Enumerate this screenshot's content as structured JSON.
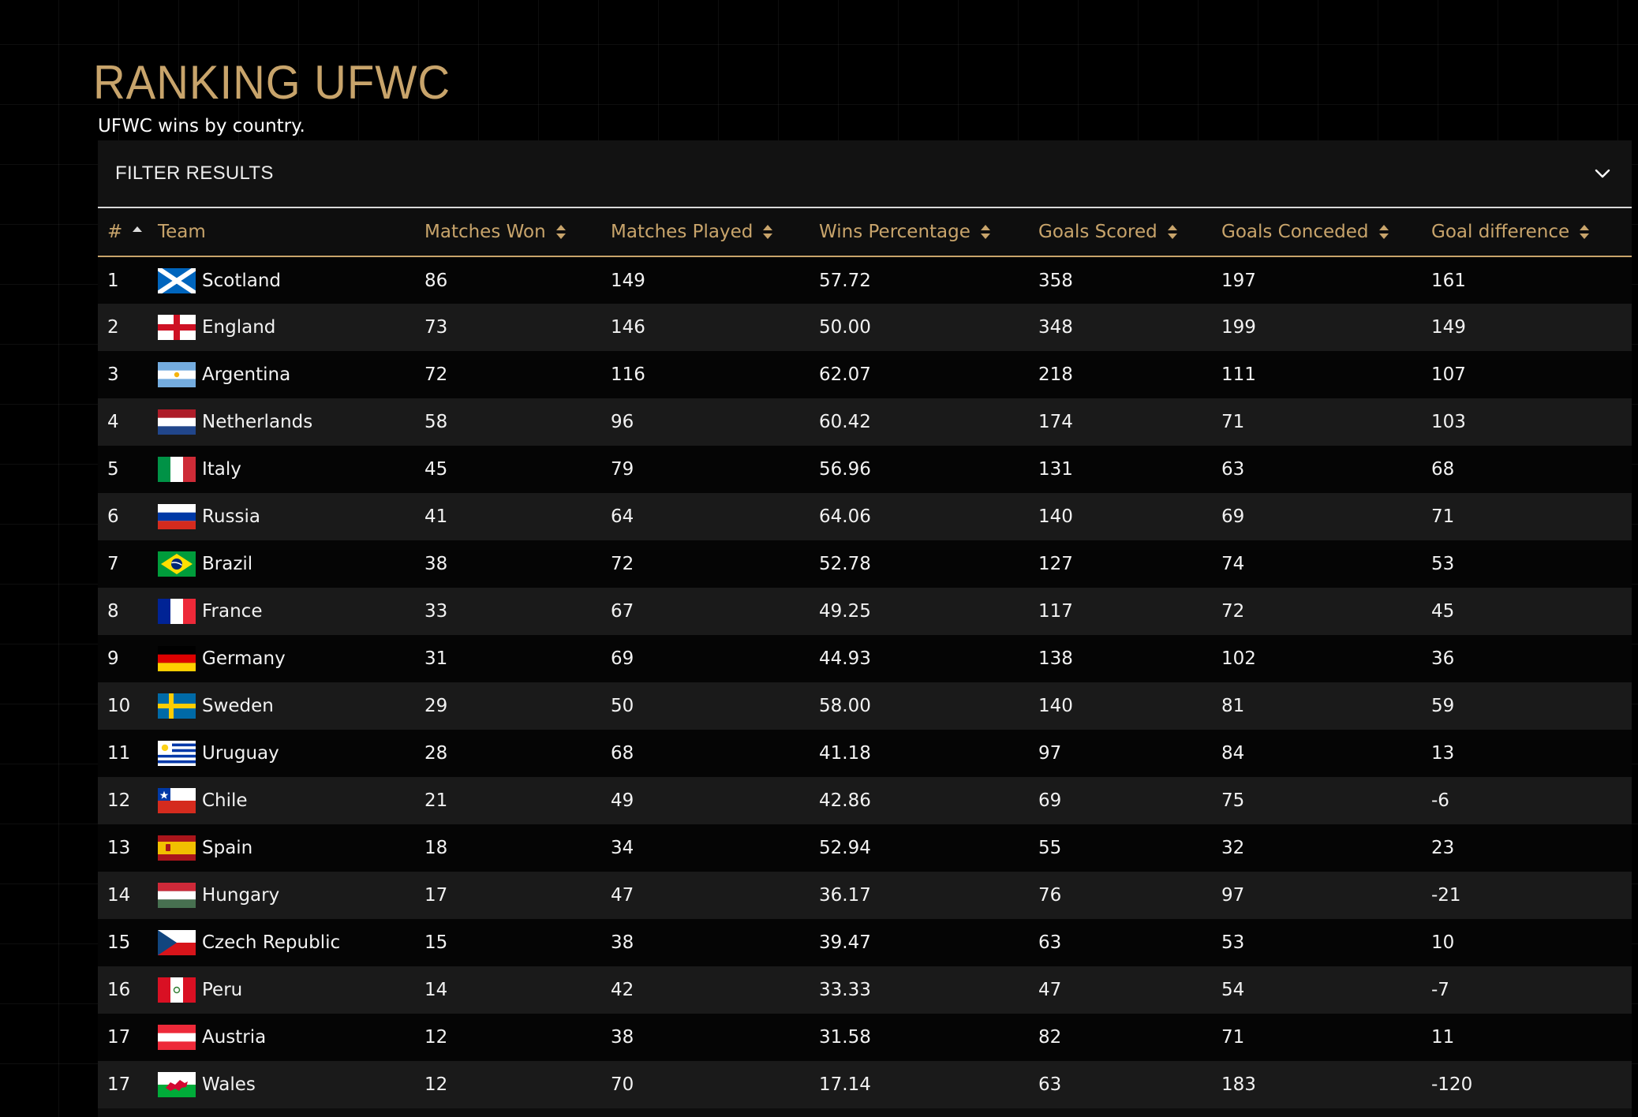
{
  "header": {
    "title": "RANKING UFWC",
    "subtitle": "UFWC wins by country."
  },
  "filter": {
    "label": "FILTER RESULTS",
    "icon": "chevron-down-icon"
  },
  "colors": {
    "accent": "#c8a46b",
    "background": "#000000",
    "row_dark": "#050505",
    "row_light": "#1a1a1a",
    "text": "#f2f2f2"
  },
  "table": {
    "sort": {
      "column": "rank",
      "direction": "ascending"
    },
    "columns": [
      {
        "key": "rank",
        "label": "#",
        "sort_icon": "sort-ascending-icon"
      },
      {
        "key": "team",
        "label": "Team",
        "sort_icon": null
      },
      {
        "key": "won",
        "label": "Matches Won",
        "sort_icon": "sort-icon"
      },
      {
        "key": "played",
        "label": "Matches Played",
        "sort_icon": "sort-icon"
      },
      {
        "key": "pct",
        "label": "Wins Percentage",
        "sort_icon": "sort-icon"
      },
      {
        "key": "scored",
        "label": "Goals Scored",
        "sort_icon": "sort-icon"
      },
      {
        "key": "conceded",
        "label": "Goals Conceded",
        "sort_icon": "sort-icon"
      },
      {
        "key": "diff",
        "label": "Goal difference",
        "sort_icon": "sort-icon"
      }
    ],
    "rows": [
      {
        "rank": "1",
        "team": "Scotland",
        "flag": "scotland-flag-icon",
        "won": "86",
        "played": "149",
        "pct": "57.72",
        "scored": "358",
        "conceded": "197",
        "diff": "161"
      },
      {
        "rank": "2",
        "team": "England",
        "flag": "england-flag-icon",
        "won": "73",
        "played": "146",
        "pct": "50.00",
        "scored": "348",
        "conceded": "199",
        "diff": "149"
      },
      {
        "rank": "3",
        "team": "Argentina",
        "flag": "argentina-flag-icon",
        "won": "72",
        "played": "116",
        "pct": "62.07",
        "scored": "218",
        "conceded": "111",
        "diff": "107"
      },
      {
        "rank": "4",
        "team": "Netherlands",
        "flag": "netherlands-flag-icon",
        "won": "58",
        "played": "96",
        "pct": "60.42",
        "scored": "174",
        "conceded": "71",
        "diff": "103"
      },
      {
        "rank": "5",
        "team": "Italy",
        "flag": "italy-flag-icon",
        "won": "45",
        "played": "79",
        "pct": "56.96",
        "scored": "131",
        "conceded": "63",
        "diff": "68"
      },
      {
        "rank": "6",
        "team": "Russia",
        "flag": "russia-flag-icon",
        "won": "41",
        "played": "64",
        "pct": "64.06",
        "scored": "140",
        "conceded": "69",
        "diff": "71"
      },
      {
        "rank": "7",
        "team": "Brazil",
        "flag": "brazil-flag-icon",
        "won": "38",
        "played": "72",
        "pct": "52.78",
        "scored": "127",
        "conceded": "74",
        "diff": "53"
      },
      {
        "rank": "8",
        "team": "France",
        "flag": "france-flag-icon",
        "won": "33",
        "played": "67",
        "pct": "49.25",
        "scored": "117",
        "conceded": "72",
        "diff": "45"
      },
      {
        "rank": "9",
        "team": "Germany",
        "flag": "germany-flag-icon",
        "won": "31",
        "played": "69",
        "pct": "44.93",
        "scored": "138",
        "conceded": "102",
        "diff": "36"
      },
      {
        "rank": "10",
        "team": "Sweden",
        "flag": "sweden-flag-icon",
        "won": "29",
        "played": "50",
        "pct": "58.00",
        "scored": "140",
        "conceded": "81",
        "diff": "59"
      },
      {
        "rank": "11",
        "team": "Uruguay",
        "flag": "uruguay-flag-icon",
        "won": "28",
        "played": "68",
        "pct": "41.18",
        "scored": "97",
        "conceded": "84",
        "diff": "13"
      },
      {
        "rank": "12",
        "team": "Chile",
        "flag": "chile-flag-icon",
        "won": "21",
        "played": "49",
        "pct": "42.86",
        "scored": "69",
        "conceded": "75",
        "diff": "-6"
      },
      {
        "rank": "13",
        "team": "Spain",
        "flag": "spain-flag-icon",
        "won": "18",
        "played": "34",
        "pct": "52.94",
        "scored": "55",
        "conceded": "32",
        "diff": "23"
      },
      {
        "rank": "14",
        "team": "Hungary",
        "flag": "hungary-flag-icon",
        "won": "17",
        "played": "47",
        "pct": "36.17",
        "scored": "76",
        "conceded": "97",
        "diff": "-21"
      },
      {
        "rank": "15",
        "team": "Czech Republic",
        "flag": "czech-republic-flag-icon",
        "won": "15",
        "played": "38",
        "pct": "39.47",
        "scored": "63",
        "conceded": "53",
        "diff": "10"
      },
      {
        "rank": "16",
        "team": "Peru",
        "flag": "peru-flag-icon",
        "won": "14",
        "played": "42",
        "pct": "33.33",
        "scored": "47",
        "conceded": "54",
        "diff": "-7"
      },
      {
        "rank": "17",
        "team": "Austria",
        "flag": "austria-flag-icon",
        "won": "12",
        "played": "38",
        "pct": "31.58",
        "scored": "82",
        "conceded": "71",
        "diff": "11"
      },
      {
        "rank": "17",
        "team": "Wales",
        "flag": "wales-flag-icon",
        "won": "12",
        "played": "70",
        "pct": "17.14",
        "scored": "63",
        "conceded": "183",
        "diff": "-120"
      }
    ]
  }
}
